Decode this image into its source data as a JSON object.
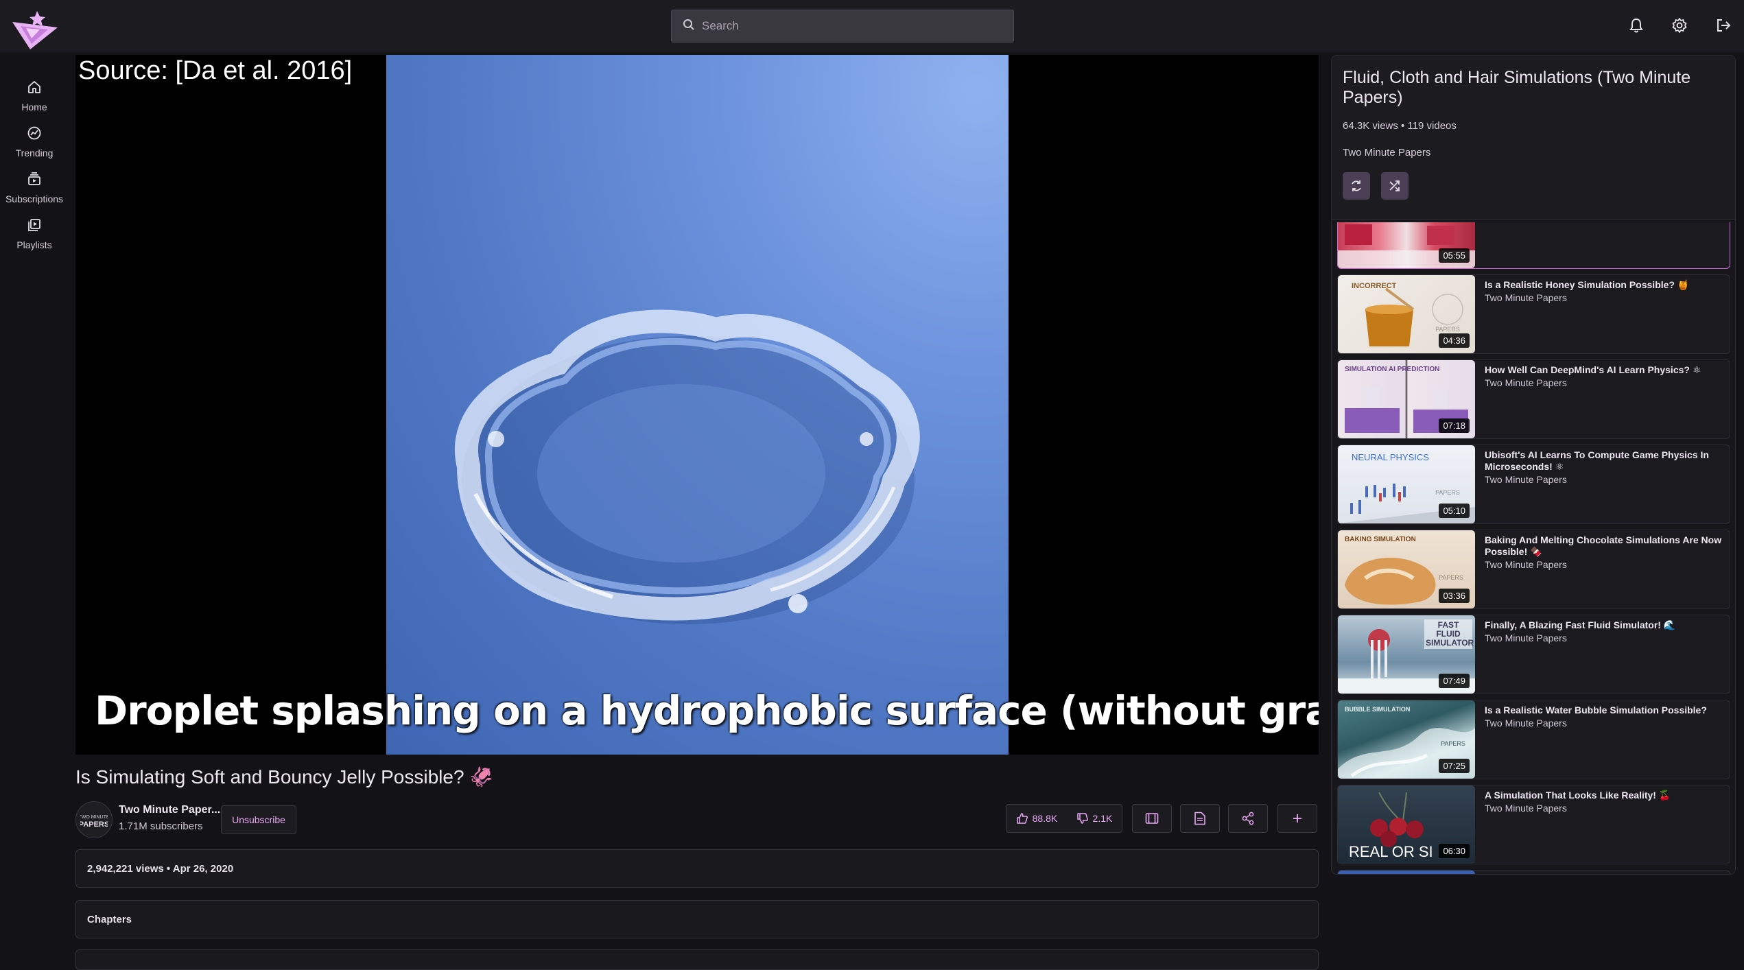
{
  "search": {
    "placeholder": "Search"
  },
  "nav": [
    {
      "label": "Home",
      "icon": "home-icon"
    },
    {
      "label": "Trending",
      "icon": "trending-icon"
    },
    {
      "label": "Subscriptions",
      "icon": "subscriptions-icon"
    },
    {
      "label": "Playlists",
      "icon": "playlists-icon"
    }
  ],
  "topbar_icons": [
    "bell-icon",
    "gear-icon",
    "logout-icon"
  ],
  "player": {
    "overlay_source": "Source: [Da et al. 2016]",
    "overlay_caption": "Droplet splashing on a hydrophobic surface (without gravity)"
  },
  "video": {
    "title": "Is Simulating Soft and Bouncy Jelly Possible? 🦑",
    "channel_name": "Two Minute Paper...",
    "subscribers": "1.71M subscribers",
    "unsubscribe_label": "Unsubscribe",
    "likes": "88.8K",
    "dislikes": "2.1K",
    "views_date": "2,942,221 views • Apr 26, 2020",
    "chapters_label": "Chapters"
  },
  "playlist": {
    "title": "Fluid, Cloth and Hair Simulations (Two Minute Papers)",
    "meta": "64.3K views • 119 videos",
    "channel": "Two Minute Papers",
    "items": [
      {
        "title": "",
        "channel": "",
        "duration": "05:55",
        "thumb_label": "",
        "current": true
      },
      {
        "title": "Is a Realistic Honey Simulation Possible? 🍯",
        "channel": "Two Minute Papers",
        "duration": "04:36",
        "thumb_label": "INCORRECT"
      },
      {
        "title": "How Well Can DeepMind's AI Learn Physics? ⚛",
        "channel": "Two Minute Papers",
        "duration": "07:18",
        "thumb_label": "SIMULATION    AI PREDICTION"
      },
      {
        "title": "Ubisoft's AI Learns To Compute Game Physics In Microseconds! ⚛",
        "channel": "Two Minute Papers",
        "duration": "05:10",
        "thumb_label": "NEURAL PHYSICS"
      },
      {
        "title": "Baking And Melting Chocolate Simulations Are Now Possible! 🍫",
        "channel": "Two Minute Papers",
        "duration": "03:36",
        "thumb_label": "BAKING SIMULATION"
      },
      {
        "title": "Finally, A Blazing Fast Fluid Simulator! 🌊",
        "channel": "Two Minute Papers",
        "duration": "07:49",
        "thumb_label": "FAST FLUID SIMULATOR"
      },
      {
        "title": "Is a Realistic Water Bubble Simulation Possible?",
        "channel": "Two Minute Papers",
        "duration": "07:25",
        "thumb_label": "BUBBLE SIMULATION"
      },
      {
        "title": "A Simulation That Looks Like Reality! 🍒",
        "channel": "Two Minute Papers",
        "duration": "06:30",
        "thumb_label": "REAL OR SI"
      }
    ]
  },
  "colors": {
    "accent": "#e9a8f5",
    "current_border": "#c16ad3",
    "background": "#131216"
  }
}
